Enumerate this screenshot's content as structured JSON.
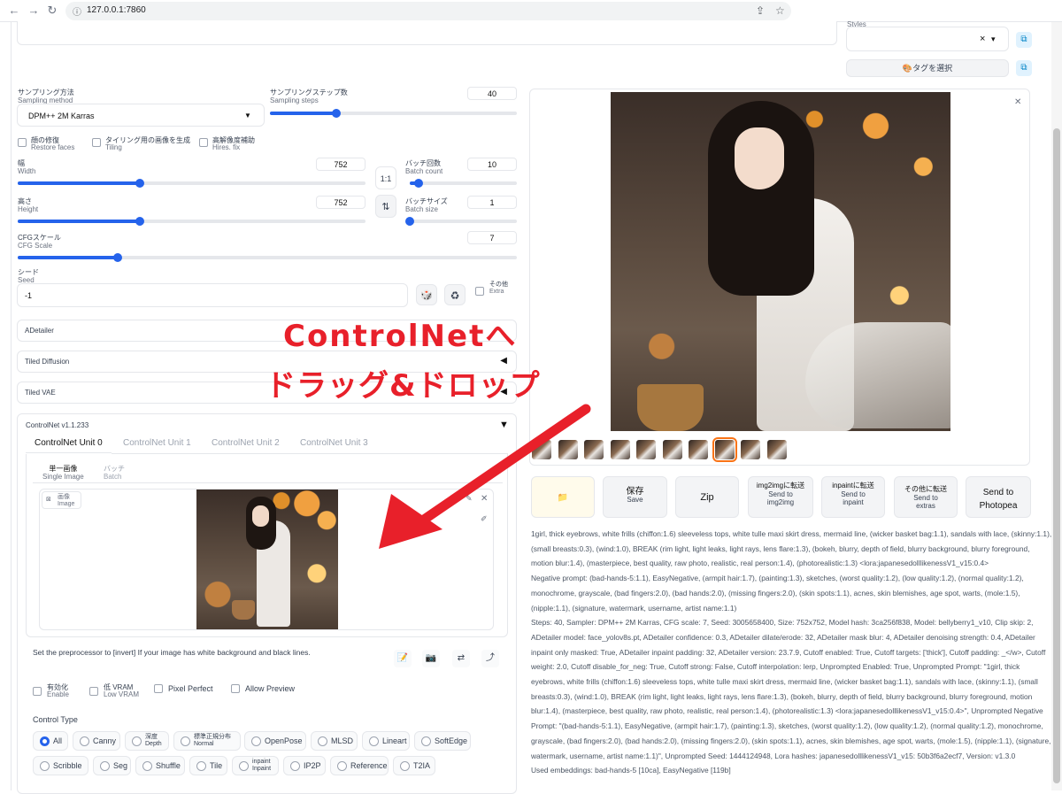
{
  "browser": {
    "url": "127.0.0.1:7860"
  },
  "styles": {
    "label": "Styles",
    "clear": "×",
    "caret": "▾",
    "tag_select": "🎨タグを選択"
  },
  "sampling": {
    "method_label": "サンプリング方法",
    "method_label_en": "Sampling method",
    "method_value": "DPM++ 2M Karras",
    "steps_label": "サンプリングステップ数",
    "steps_label_en": "Sampling steps",
    "steps_value": "40",
    "steps_fraction": 0.27
  },
  "checkboxes": [
    {
      "label": "顔の修復",
      "sub": "Restore faces"
    },
    {
      "label": "タイリング用の画像を生成",
      "sub": "Tiling"
    },
    {
      "label": "高解像度補助",
      "sub": "Hires. fix"
    }
  ],
  "width": {
    "label": "幅",
    "label_en": "Width",
    "value": "752",
    "fraction": 0.35
  },
  "height": {
    "label": "高さ",
    "label_en": "Height",
    "value": "752",
    "fraction": 0.35
  },
  "batch_count": {
    "label": "バッチ回数",
    "label_en": "Batch count",
    "value": "10",
    "fraction": 0.08
  },
  "batch_size": {
    "label": "バッチサイズ",
    "label_en": "Batch size",
    "value": "1",
    "fraction": 0.0
  },
  "swap_ratio": "1:1",
  "swap_icon": "⇅",
  "cfg": {
    "label": "CFGスケール",
    "label_en": "CFG Scale",
    "value": "7",
    "fraction": 0.2
  },
  "seed": {
    "label": "シード",
    "label_en": "Seed",
    "value": "-1",
    "extra_label": "その他",
    "extra_sub": "Extra"
  },
  "accordions": [
    {
      "title": "ADetailer"
    },
    {
      "title": "Tiled Diffusion",
      "arrow": "◀"
    },
    {
      "title": "Tiled VAE",
      "arrow": "◀"
    }
  ],
  "controlnet": {
    "title": "ControlNet v1.1.233",
    "arrow": "▼",
    "units": [
      "ControlNet Unit 0",
      "ControlNet Unit 1",
      "ControlNet Unit 2",
      "ControlNet Unit 3"
    ],
    "subtabs": [
      {
        "label": "単一画像",
        "sub": "Single Image"
      },
      {
        "label": "バッチ",
        "sub": "Batch"
      }
    ],
    "image_label": "画像",
    "image_label_en": "Image",
    "hint": "Set the preprocessor to [invert] If your image has white background and black lines.",
    "options": [
      {
        "label": "有効化",
        "sub": "Enable"
      },
      {
        "label": "低 VRAM",
        "sub": "Low VRAM"
      },
      {
        "label": "Pixel Perfect",
        "sub": ""
      },
      {
        "label": "Allow Preview",
        "sub": ""
      }
    ],
    "control_type_label": "Control Type",
    "types_row1": [
      {
        "label": "All"
      },
      {
        "label": "Canny"
      },
      {
        "label": "深度",
        "sub": "Depth"
      },
      {
        "label": "標準正規分布",
        "sub": "Normal"
      },
      {
        "label": "OpenPose"
      },
      {
        "label": "MLSD"
      },
      {
        "label": "Lineart"
      },
      {
        "label": "SoftEdge"
      }
    ],
    "types_row2": [
      {
        "label": "Scribble"
      },
      {
        "label": "Seg"
      },
      {
        "label": "Shuffle"
      },
      {
        "label": "Tile"
      },
      {
        "label": "inpaint",
        "sub": "Inpaint"
      },
      {
        "label": "IP2P"
      },
      {
        "label": "Reference"
      },
      {
        "label": "T2IA"
      }
    ]
  },
  "overlay": {
    "line1": "ControlNetへ",
    "line2": "ドラッグ&ドロップ",
    "color": "#e8202a"
  },
  "actions": [
    {
      "big": "📁",
      "small": ""
    },
    {
      "big": "保存",
      "small": "Save"
    },
    {
      "big": "Zip",
      "small": ""
    },
    {
      "big": "img2imgに転送",
      "small": "Send to img2img"
    },
    {
      "big": "inpaintに転送",
      "small": "Send to inpaint"
    },
    {
      "big": "その他に転送",
      "small": "Send to extras"
    },
    {
      "big": "Send to Photopea",
      "small": ""
    }
  ],
  "info": {
    "prompt": "1girl, thick eyebrows, white frills (chiffon:1.6) sleeveless tops, white tulle maxi skirt dress, mermaid line, (wicker basket bag:1.1), sandals with lace, (skinny:1.1), (small breasts:0.3), (wind:1.0), BREAK (rim light, light leaks, light rays, lens flare:1.3), (bokeh, blurry, depth of field, blurry background, blurry foreground, motion blur:1.4), (masterpiece, best quality, raw photo, realistic, real person:1.4), (photorealistic:1.3) <lora:japanesedolllikenessV1_v15:0.4>",
    "negative": "Negative prompt: (bad-hands-5:1.1), EasyNegative, (armpit hair:1.7), (painting:1.3), sketches, (worst quality:1.2), (low quality:1.2), (normal quality:1.2), monochrome, grayscale, (bad fingers:2.0), (bad hands:2.0), (missing fingers:2.0), (skin spots:1.1), acnes, skin blemishes, age spot, warts, (mole:1.5), (nipple:1.1), (signature, watermark, username, artist name:1.1)",
    "params": "Steps: 40, Sampler: DPM++ 2M Karras, CFG scale: 7, Seed: 3005658400, Size: 752x752, Model hash: 3ca256f838, Model: bellyberry1_v10, Clip skip: 2, ADetailer model: face_yolov8s.pt, ADetailer confidence: 0.3, ADetailer dilate/erode: 32, ADetailer mask blur: 4, ADetailer denoising strength: 0.4, ADetailer inpaint only masked: True, ADetailer inpaint padding: 32, ADetailer version: 23.7.9, Cutoff enabled: True, Cutoff targets: ['thick'], Cutoff padding: _</w>, Cutoff weight: 2.0, Cutoff disable_for_neg: True, Cutoff strong: False, Cutoff interpolation: lerp, Unprompted Enabled: True, Unprompted Prompt: \"1girl, thick eyebrows, white frills (chiffon:1.6) sleeveless tops, white tulle maxi skirt dress, mermaid line, (wicker basket bag:1.1), sandals with lace, (skinny:1.1), (small breasts:0.3), (wind:1.0), BREAK (rim light, light leaks, light rays, lens flare:1.3), (bokeh, blurry, depth of field, blurry background, blurry foreground, motion blur:1.4), (masterpiece, best quality, raw photo, realistic, real person:1.4), (photorealistic:1.3) <lora:japanesedolllikenessV1_v15:0.4>\", Unprompted Negative Prompt: \"(bad-hands-5:1.1), EasyNegative, (armpit hair:1.7), (painting:1.3), sketches, (worst quality:1.2), (low quality:1.2), (normal quality:1.2), monochrome, grayscale, (bad fingers:2.0), (bad hands:2.0), (missing fingers:2.0), (skin spots:1.1), acnes, skin blemishes, age spot, warts, (mole:1.5), (nipple:1.1), (signature, watermark, username, artist name:1.1)\", Unprompted Seed: 1444124948, Lora hashes: japanesedolllikenessV1_v15: 50b3f6a2ecf7, Version: v1.3.0",
    "embeddings": "Used embeddings: bad-hands-5 [10ca], EasyNegative [119b]"
  }
}
